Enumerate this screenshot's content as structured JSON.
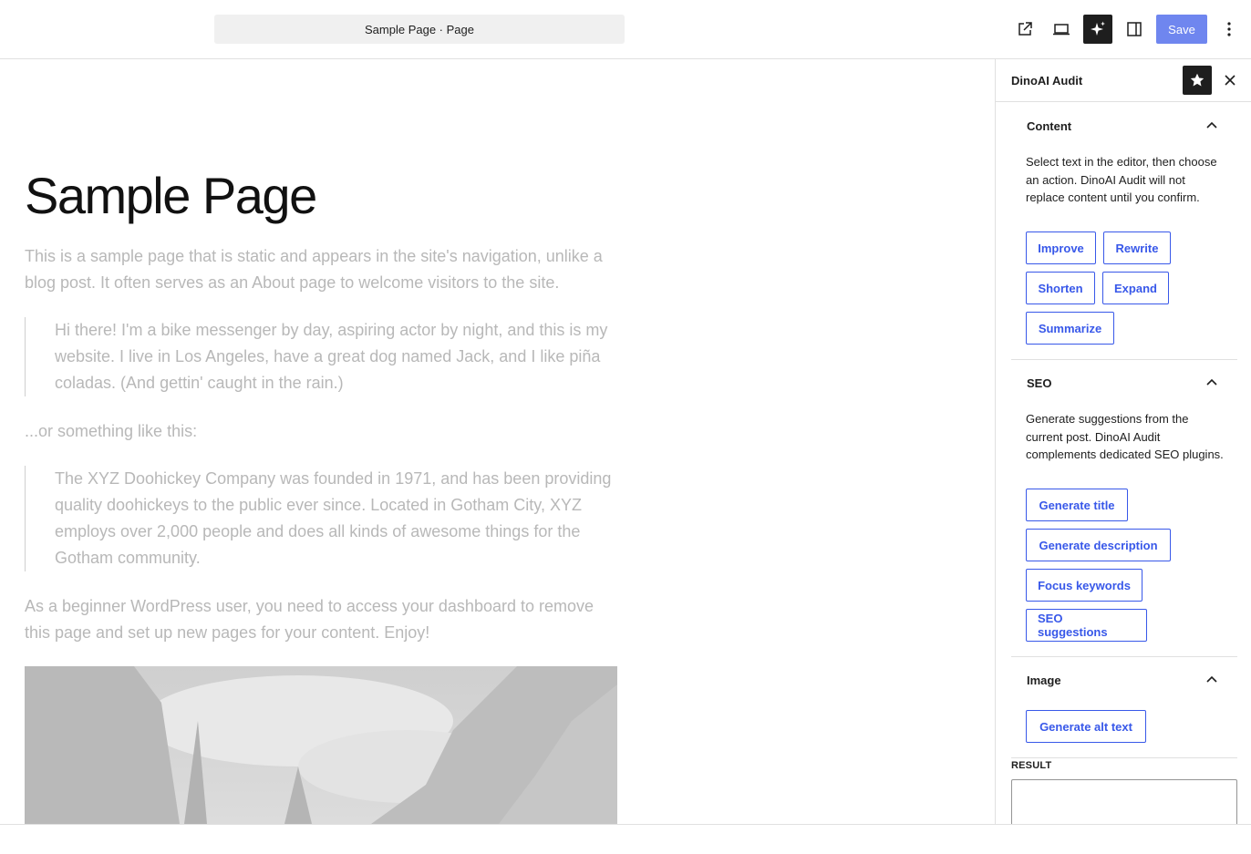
{
  "topbar": {
    "document_title": "Sample Page · Page",
    "save_label": "Save",
    "accent_color": "#3858e9"
  },
  "icons": {
    "view": "external-link-icon",
    "preview": "laptop-icon",
    "ai": "sparkle-icon",
    "settings": "sidebar-toggle-icon",
    "more": "vertical-ellipsis-icon",
    "star": "star-icon",
    "close": "close-icon",
    "chevron": "chevron-up-icon"
  },
  "editor": {
    "title": "Sample Page",
    "intro": "This is a sample page that is static and appears in the site's navigation, unlike a blog post. It often serves as an About page to welcome visitors to the site.",
    "quote1": "Hi there! I'm a bike messenger by day, aspiring actor by night, and this is my website. I live in Los Angeles, have a great dog named Jack, and I like piña coladas. (And gettin' caught in the rain.)",
    "or_text": "...or something like this:",
    "quote2": "The XYZ Doohickey Company was founded in 1971, and has been providing quality doohickeys to the public ever since. Located in Gotham City, XYZ employs over 2,000 people and does all kinds of awesome things for the Gotham community.",
    "outro": "As a beginner WordPress user, you need to access your dashboard to remove this page and set up new pages for your content. Enjoy!"
  },
  "sidebar": {
    "title": "DinoAI Audit",
    "content_panel": {
      "title": "Content",
      "description": "Select text in the editor, then choose an action. DinoAI Audit will not replace content until you confirm.",
      "buttons": [
        "Improve",
        "Rewrite",
        "Shorten",
        "Expand",
        "Summarize"
      ]
    },
    "seo_panel": {
      "title": "SEO",
      "description": "Generate suggestions from the current post. DinoAI Audit complements dedicated SEO plugins.",
      "buttons": [
        "Generate title",
        "Generate description",
        "Focus keywords",
        "SEO suggestions"
      ]
    },
    "image_panel": {
      "title": "Image",
      "buttons": [
        "Generate alt text"
      ]
    },
    "result_label": "RESULT"
  }
}
